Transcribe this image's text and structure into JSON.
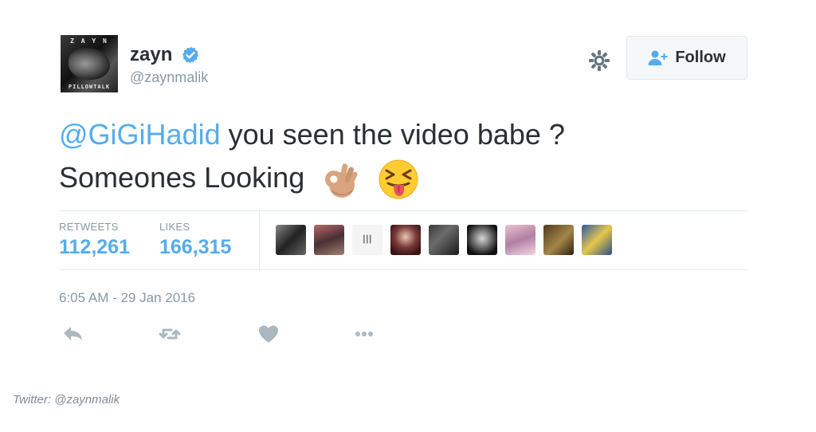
{
  "user": {
    "display_name": "zayn",
    "handle": "@zaynmalik",
    "verified": true,
    "avatar_top_text": "Z A Y N",
    "avatar_bottom_text": "PILLOWTALK"
  },
  "header": {
    "settings_icon": "gear-icon",
    "follow_label": "Follow",
    "follow_icon": "add-user-icon"
  },
  "tweet": {
    "mention": "@GiGiHadid",
    "text_after_mention": " you seen the video babe ?",
    "line2": "Someones Looking",
    "emojis": [
      "ok-hand-emoji",
      "squinting-tongue-emoji"
    ]
  },
  "stats": {
    "retweets_label": "RETWEETS",
    "retweets_value": "112,261",
    "likes_label": "LIKES",
    "likes_value": "166,315",
    "liker_avatar_count": 9
  },
  "timestamp": "6:05 AM - 29 Jan 2016",
  "actions": [
    "reply-icon",
    "retweet-icon",
    "heart-icon",
    "more-icon"
  ],
  "caption": "Twitter: @zaynmalik",
  "colors": {
    "accent": "#55acee",
    "text": "#292f33",
    "muted": "#8899a6",
    "icon": "#aab8c2",
    "border": "#e1e8ed"
  }
}
